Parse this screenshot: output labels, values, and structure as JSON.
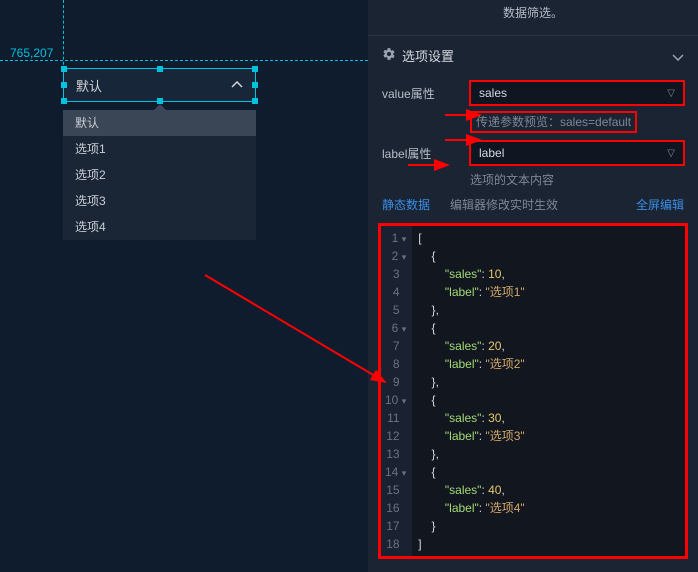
{
  "coord": "765,207",
  "dropdown": {
    "label": "默认"
  },
  "menu": {
    "items": [
      "默认",
      "选项1",
      "选项2",
      "选项3",
      "选项4"
    ]
  },
  "panel": {
    "filter_note": "数据筛选。",
    "section_title": "选项设置",
    "value_field": {
      "label": "value属性",
      "value": "sales"
    },
    "param_preview": "传递参数预览：sales=default",
    "label_field": {
      "label": "label属性",
      "value": "label"
    },
    "label_hint": "选项的文本内容",
    "static_data": "静态数据",
    "static_hint": "编辑器修改实时生效",
    "full_edit": "全屏编辑"
  },
  "code": {
    "raw": [
      {
        "sales": 10,
        "label": "选项1"
      },
      {
        "sales": 20,
        "label": "选项2"
      },
      {
        "sales": 30,
        "label": "选项3"
      },
      {
        "sales": 40,
        "label": "选项4"
      }
    ]
  }
}
